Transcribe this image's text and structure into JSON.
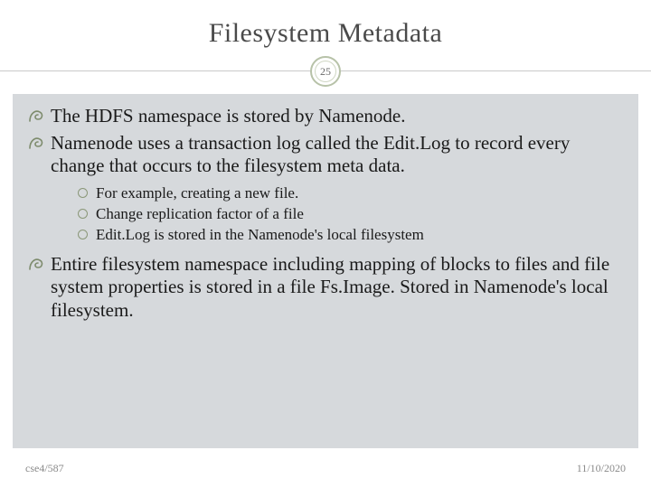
{
  "title": "Filesystem Metadata",
  "slide_number": "25",
  "bullets": {
    "b0": "The HDFS namespace is stored by Namenode.",
    "b1": "Namenode uses a transaction log called the Edit.Log to record every change that occurs to the filesystem meta data.",
    "b1_sub": {
      "s0": "For example, creating a new file.",
      "s1": "Change replication factor of a file",
      "s2": "Edit.Log is stored in the Namenode's local filesystem"
    },
    "b2": "Entire filesystem namespace including mapping of blocks to files and file system properties is stored in a file Fs.Image. Stored in Namenode's local filesystem."
  },
  "footer": {
    "left": "cse4/587",
    "right": "11/10/2020"
  }
}
